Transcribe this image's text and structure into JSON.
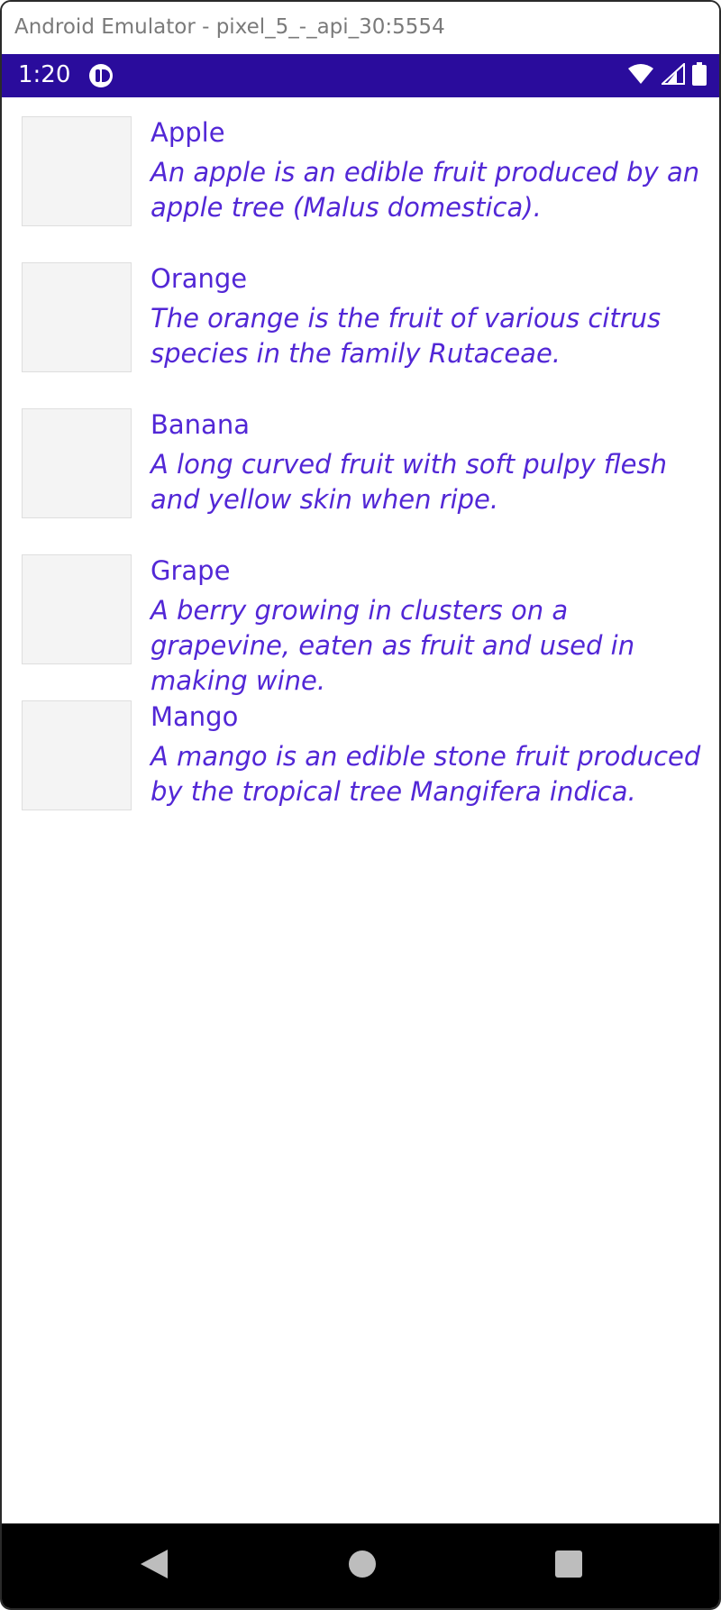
{
  "window": {
    "title": "Android Emulator - pixel_5_-_api_30:5554"
  },
  "status_bar": {
    "time": "1:20",
    "background_color": "#2a0c9c",
    "icons": [
      "app-notification-icon",
      "wifi-icon",
      "signal-icon",
      "battery-icon"
    ]
  },
  "list": {
    "accent_color": "#5227d6",
    "items": [
      {
        "title": "Apple",
        "description": "An apple is an edible fruit produced by an apple tree (Malus domestica)."
      },
      {
        "title": "Orange",
        "description": "The orange is the fruit of various citrus species in the family Rutaceae."
      },
      {
        "title": "Banana",
        "description": "A long curved fruit with soft pulpy flesh and yellow skin when ripe."
      },
      {
        "title": "Grape",
        "description": "A berry growing in clusters on a grapevine, eaten as fruit and used in making wine."
      },
      {
        "title": "Mango",
        "description": "A mango is an edible stone fruit produced by the tropical tree Mangifera indica."
      }
    ]
  },
  "nav_bar": {
    "buttons": [
      "back-icon",
      "home-icon",
      "recents-icon"
    ]
  }
}
